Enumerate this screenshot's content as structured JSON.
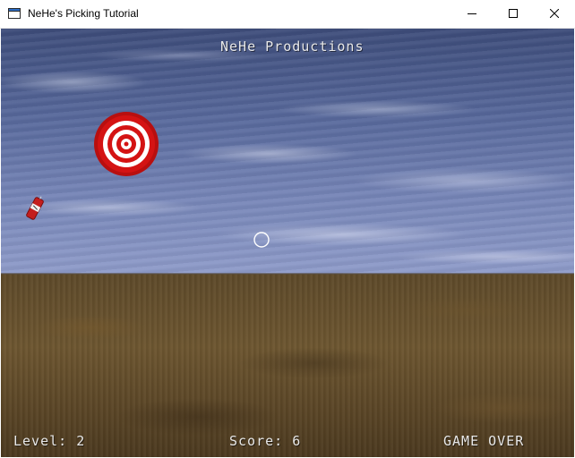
{
  "window": {
    "title": "NeHe's Picking Tutorial",
    "controls": [
      "minimize",
      "maximize",
      "close"
    ]
  },
  "hud": {
    "title": "NeHe Productions",
    "level_text": "Level: 2",
    "score_text": "Score: 6",
    "status_text": "GAME OVER"
  },
  "game": {
    "level": 2,
    "score": 6,
    "state": "game over",
    "objects": [
      {
        "type": "target-icon",
        "colors": [
          "#cc1111",
          "#ffffff"
        ]
      },
      {
        "type": "dynamite-icon",
        "colors": [
          "#cc2222",
          "#ffffff"
        ]
      },
      {
        "type": "crosshair-icon",
        "colors": [
          "#ffffff"
        ]
      }
    ]
  },
  "colors": {
    "sky": "#6a79ad",
    "ground": "#6a5330",
    "hud_text": "#e8e8e8",
    "target_red": "#cc1111"
  }
}
